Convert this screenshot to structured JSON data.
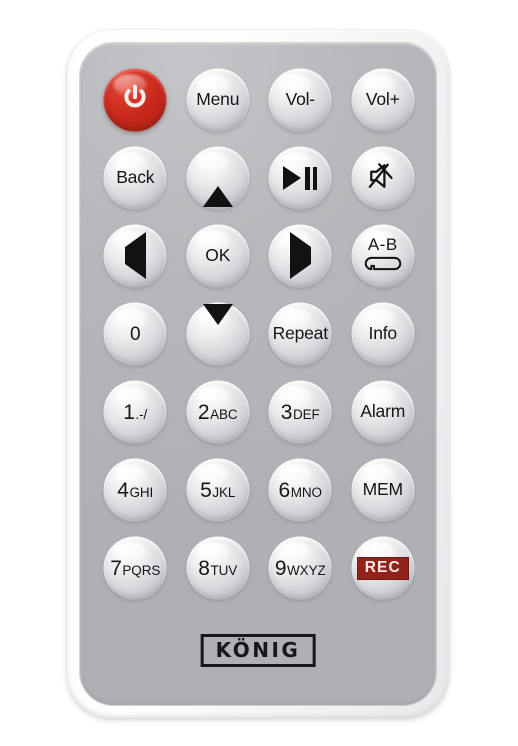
{
  "device": {
    "type": "infrared-remote-control",
    "brand": "KÖNIG",
    "shell_color": "#f4f4f5",
    "keypad_color": "#b6b8bb",
    "accent_red": "#c9291c",
    "rec_red": "#93221a",
    "label_color": "#15161a"
  },
  "keys": [
    {
      "name": "power",
      "label": "",
      "icon": "power-icon",
      "style": "power"
    },
    {
      "name": "menu",
      "label": "Menu",
      "icon": "",
      "style": "text"
    },
    {
      "name": "volume-down",
      "label": "Vol-",
      "icon": "",
      "style": "text"
    },
    {
      "name": "volume-up",
      "label": "Vol+",
      "icon": "",
      "style": "text"
    },
    {
      "name": "back",
      "label": "Back",
      "icon": "",
      "style": "text"
    },
    {
      "name": "up",
      "label": "",
      "icon": "arrow-up-icon",
      "style": "icon"
    },
    {
      "name": "play-pause",
      "label": "",
      "icon": "play-pause-icon",
      "style": "icon"
    },
    {
      "name": "mute",
      "label": "",
      "icon": "mute-icon",
      "style": "icon"
    },
    {
      "name": "left",
      "label": "",
      "icon": "arrow-left-icon",
      "style": "icon"
    },
    {
      "name": "ok",
      "label": "OK",
      "icon": "",
      "style": "text"
    },
    {
      "name": "right",
      "label": "",
      "icon": "arrow-right-icon",
      "style": "icon"
    },
    {
      "name": "a-b-repeat",
      "label": "A-B",
      "icon": "loop-icon",
      "style": "ab"
    },
    {
      "name": "digit-0",
      "label": "0",
      "icon": "",
      "style": "zero"
    },
    {
      "name": "down",
      "label": "",
      "icon": "arrow-down-icon",
      "style": "icon"
    },
    {
      "name": "repeat",
      "label": "Repeat",
      "icon": "",
      "style": "text"
    },
    {
      "name": "info",
      "label": "Info",
      "icon": "",
      "style": "text"
    },
    {
      "name": "digit-1",
      "digit": "1",
      "letters": ".-/",
      "style": "num"
    },
    {
      "name": "digit-2",
      "digit": "2",
      "letters": "ABC",
      "style": "num"
    },
    {
      "name": "digit-3",
      "digit": "3",
      "letters": "DEF",
      "style": "num"
    },
    {
      "name": "alarm",
      "label": "Alarm",
      "icon": "",
      "style": "text"
    },
    {
      "name": "digit-4",
      "digit": "4",
      "letters": "GHI",
      "style": "num"
    },
    {
      "name": "digit-5",
      "digit": "5",
      "letters": "JKL",
      "style": "num"
    },
    {
      "name": "digit-6",
      "digit": "6",
      "letters": "MNO",
      "style": "num"
    },
    {
      "name": "memory",
      "label": "MEM",
      "icon": "",
      "style": "text"
    },
    {
      "name": "digit-7",
      "digit": "7",
      "letters": "PQRS",
      "style": "num"
    },
    {
      "name": "digit-8",
      "digit": "8",
      "letters": "TUV",
      "style": "num"
    },
    {
      "name": "digit-9",
      "digit": "9",
      "letters": "WXYZ",
      "style": "num"
    },
    {
      "name": "record",
      "label": "REC",
      "icon": "",
      "style": "rec"
    }
  ],
  "brand": {
    "text": "KÖNIG"
  }
}
